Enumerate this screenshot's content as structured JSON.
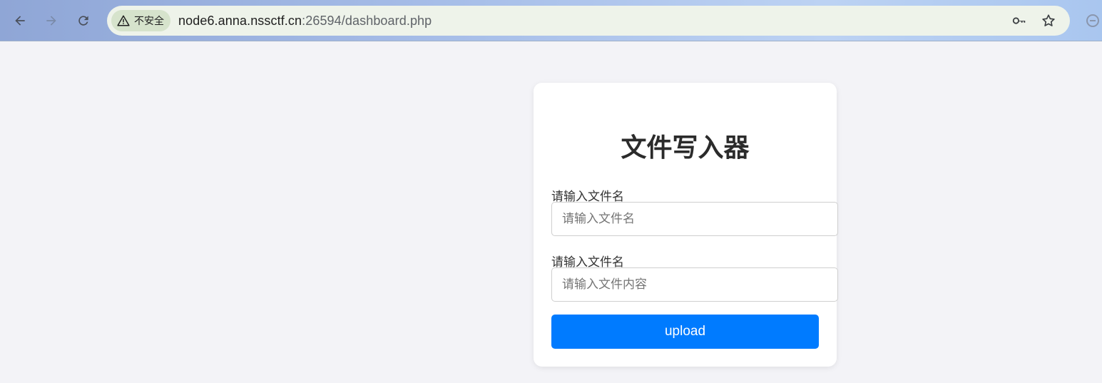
{
  "browser": {
    "security_label": "不安全",
    "url_host": "node6.anna.nssctf.cn",
    "url_rest": ":26594/dashboard.php",
    "icons": {
      "back": "arrow-left-icon",
      "forward": "arrow-right-icon",
      "reload": "reload-icon",
      "security": "warning-triangle-icon",
      "password": "key-icon",
      "bookmark": "star-icon",
      "extension": "minus-circle-icon"
    }
  },
  "page": {
    "title": "文件写入器",
    "filename_label": "请输入文件名",
    "filename_placeholder": "请输入文件名",
    "content_label": "请输入文件名",
    "content_placeholder": "请输入文件内容",
    "upload_label": "upload",
    "accent_color": "#007bff"
  }
}
